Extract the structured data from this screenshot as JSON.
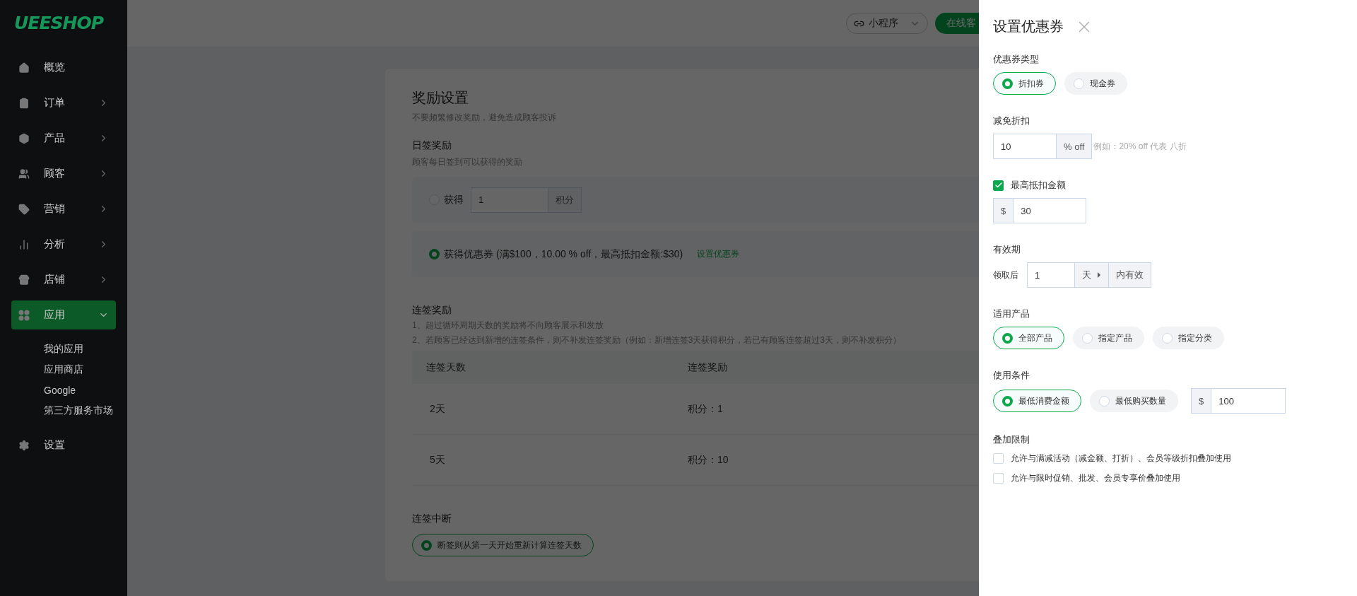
{
  "topbar": {
    "mini_program": "小程序",
    "service_button": "在线客"
  },
  "sidebar": {
    "logo": "UEESHOP",
    "items": [
      {
        "label": "概览",
        "selected": false
      },
      {
        "label": "订单",
        "selected": false,
        "expanded": false
      },
      {
        "label": "产品",
        "selected": false,
        "expanded": false
      },
      {
        "label": "顾客",
        "selected": false,
        "expanded": false
      },
      {
        "label": "营销",
        "selected": false,
        "expanded": false
      },
      {
        "label": "分析",
        "selected": false,
        "expanded": false
      },
      {
        "label": "店铺",
        "selected": false,
        "expanded": false
      },
      {
        "label": "应用",
        "selected": true,
        "expanded": true,
        "children": [
          {
            "label": "我的应用"
          },
          {
            "label": "应用商店"
          },
          {
            "label": "Google"
          },
          {
            "label": "第三方服务市场"
          }
        ]
      },
      {
        "label": "设置",
        "selected": false
      }
    ]
  },
  "main": {
    "title": "奖励设置",
    "subtitle": "不要频繁修改奖励，避免造成顾客投诉",
    "daily": {
      "title": "日签奖励",
      "desc": "顾客每日签到可以获得的奖励",
      "options": [
        {
          "kind": "points",
          "selected": false,
          "label": "获得",
          "value": "1",
          "unit": "积分"
        },
        {
          "kind": "coupon",
          "selected": true,
          "label": "获得优惠券 (满$100，10.00 % off，最高抵扣金额:$30)",
          "link": "设置优惠券"
        }
      ]
    },
    "streak": {
      "title": "连签奖励",
      "notes": [
        "1、超过循环周期天数的奖励将不向顾客展示和发放",
        "2、若顾客已经达到新增的连签条件，则不补发连签奖励（例如：新增连签3天获得积分，若已有顾客连签超过3天，则不补发积分）"
      ],
      "columns": [
        "连签天数",
        "连签奖励"
      ],
      "rows": [
        [
          "2天",
          "积分：1"
        ],
        [
          "5天",
          "积分：10"
        ]
      ]
    },
    "break": {
      "title": "连签中断",
      "option": {
        "label": "断签则从第一天开始重新计算连签天数",
        "selected": true
      }
    }
  },
  "drawer": {
    "title": "设置优惠券",
    "sections": [
      {
        "kind": "radio",
        "label": "优惠券类型",
        "options": [
          {
            "label": "折扣券",
            "selected": true
          },
          {
            "label": "现金券",
            "selected": false
          }
        ]
      },
      {
        "kind": "suffix_input",
        "label": "减免折扣",
        "value": "10",
        "suffix": "% off",
        "hint": "例如：20% off 代表 八折"
      },
      {
        "kind": "check_input",
        "label": "最高抵扣金额",
        "checked": true,
        "prefix": "$",
        "value": "30"
      },
      {
        "kind": "validity",
        "label": "有效期",
        "before": "领取后",
        "value": "1",
        "unit": "天",
        "after": "内有效"
      },
      {
        "kind": "radio",
        "label": "适用产品",
        "options": [
          {
            "label": "全部产品",
            "selected": true
          },
          {
            "label": "指定产品",
            "selected": false
          },
          {
            "label": "指定分类",
            "selected": false
          }
        ]
      },
      {
        "kind": "radio",
        "label": "使用条件",
        "options": [
          {
            "label": "最低消费金额",
            "selected": true
          },
          {
            "label": "最低购买数量",
            "selected": false
          }
        ],
        "prefix": "$",
        "value": "100"
      },
      {
        "kind": "checks",
        "label": "叠加限制",
        "items": [
          {
            "label": "允许与满减活动（减金额、打折）、会员等级折扣叠加使用",
            "checked": false
          },
          {
            "label": "允许与限时促销、批发、会员专享价叠加使用",
            "checked": false
          }
        ]
      }
    ]
  }
}
